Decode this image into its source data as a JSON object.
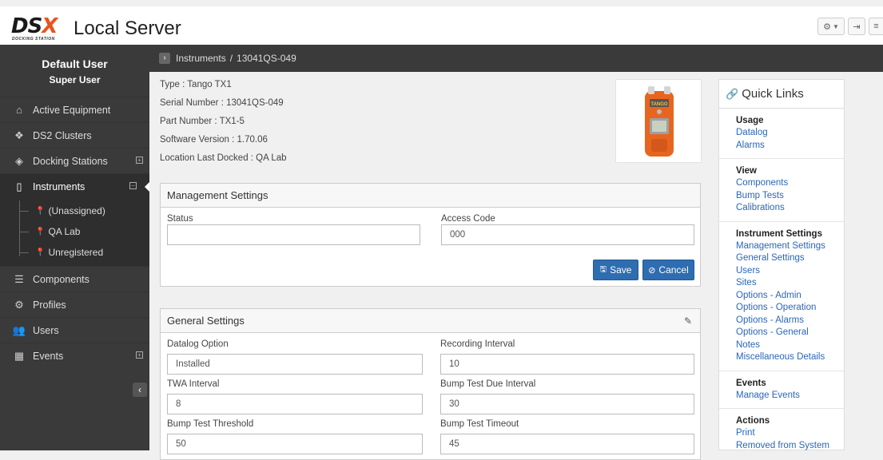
{
  "brand": {
    "logo": "DSX",
    "logo_sub": "DOCKING STATION",
    "title": "Local Server"
  },
  "toolbar": {
    "gear_icon": "gear-icon",
    "signout_icon": "sign-out-icon",
    "menu_icon": "hamburger-icon"
  },
  "user": {
    "name": "Default User",
    "role": "Super User"
  },
  "nav": {
    "items": [
      {
        "label": "Active Equipment",
        "icon": "home-icon"
      },
      {
        "label": "DS2 Clusters",
        "icon": "cubes-icon"
      },
      {
        "label": "Docking Stations",
        "icon": "cube-icon"
      },
      {
        "label": "Instruments",
        "icon": "instrument-icon"
      },
      {
        "label": "Components",
        "icon": "database-icon"
      },
      {
        "label": "Profiles",
        "icon": "gears-icon"
      },
      {
        "label": "Users",
        "icon": "users-icon"
      },
      {
        "label": "Events",
        "icon": "calendar-icon"
      }
    ],
    "instrument_children": [
      "(Unassigned)",
      "QA Lab",
      "Unregistered"
    ]
  },
  "breadcrumb": {
    "section": "Instruments",
    "separator": "/",
    "current": "13041QS-049"
  },
  "instrument": {
    "type": "Type : Tango TX1",
    "serial": "Serial Number : 13041QS-049",
    "part": "Part Number : TX1-5",
    "software": "Software Version : 1.70.06",
    "location": "Location Last Docked : QA Lab",
    "image_label": "TANGO"
  },
  "management": {
    "title": "Management Settings",
    "status_label": "Status",
    "status_value": "",
    "access_label": "Access Code",
    "access_value": "000",
    "save_label": "Save",
    "cancel_label": "Cancel"
  },
  "general": {
    "title": "General Settings",
    "datalog_label": "Datalog Option",
    "datalog_value": "Installed",
    "recording_label": "Recording Interval",
    "recording_value": "10",
    "twa_label": "TWA Interval",
    "twa_value": "8",
    "bump_due_label": "Bump Test Due Interval",
    "bump_due_value": "30",
    "bump_threshold_label": "Bump Test Threshold",
    "bump_threshold_value": "50",
    "bump_timeout_label": "Bump Test Timeout",
    "bump_timeout_value": "45"
  },
  "quick_links": {
    "title": "Quick Links",
    "sections": [
      {
        "heading": "Usage",
        "links": [
          "Datalog",
          "Alarms"
        ]
      },
      {
        "heading": "View",
        "links": [
          "Components",
          "Bump Tests",
          "Calibrations"
        ]
      },
      {
        "heading": "Instrument Settings",
        "links": [
          "Management Settings",
          "General Settings",
          "Users",
          "Sites",
          "Options - Admin",
          "Options - Operation",
          "Options - Alarms",
          "Options - General",
          "Notes",
          "Miscellaneous Details"
        ]
      },
      {
        "heading": "Events",
        "links": [
          "Manage Events"
        ]
      },
      {
        "heading": "Actions",
        "links": [
          "Print",
          "Removed from System"
        ]
      }
    ]
  }
}
